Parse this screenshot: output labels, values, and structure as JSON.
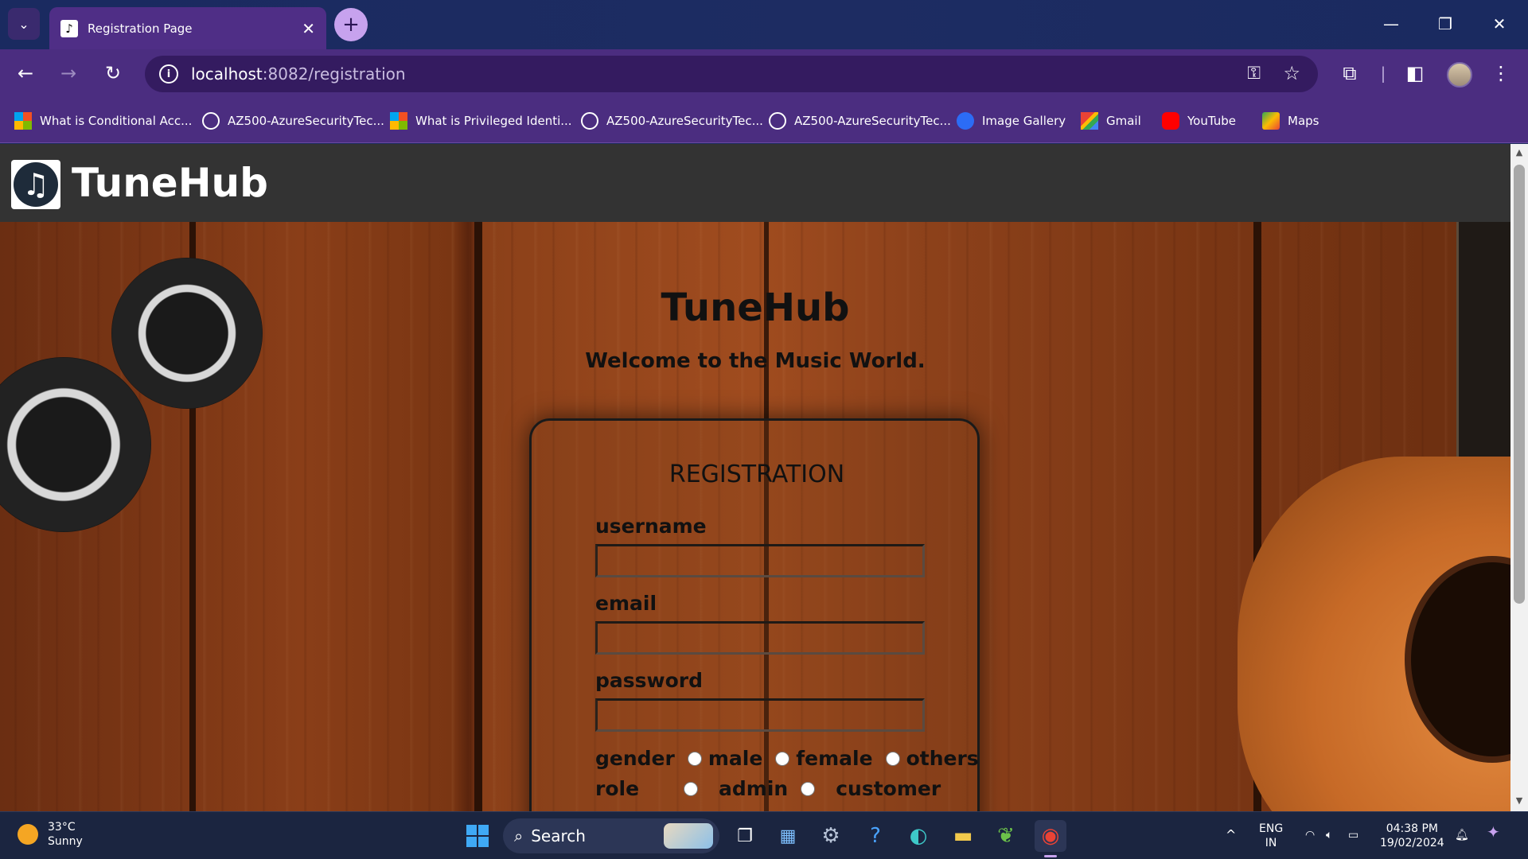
{
  "browser": {
    "tab_title": "Registration Page",
    "url_host": "localhost",
    "url_path": ":8082/registration",
    "bookmarks": [
      {
        "label": "What is Conditional Acc...",
        "icon": "microsoft-icon"
      },
      {
        "label": "AZ500-AzureSecurityTec...",
        "icon": "globe-icon"
      },
      {
        "label": "What is Privileged Identi...",
        "icon": "microsoft-icon"
      },
      {
        "label": "AZ500-AzureSecurityTec...",
        "icon": "globe-icon"
      },
      {
        "label": "AZ500-AzureSecurityTec...",
        "icon": "globe-icon"
      },
      {
        "label": "Image Gallery",
        "icon": "gallery-icon"
      },
      {
        "label": "Gmail",
        "icon": "gmail-icon"
      },
      {
        "label": "YouTube",
        "icon": "youtube-icon"
      },
      {
        "label": "Maps",
        "icon": "maps-icon"
      }
    ]
  },
  "site": {
    "brand": "TuneHub",
    "hero_title": "TuneHub",
    "hero_subtitle": "Welcome to the Music World.",
    "form": {
      "title": "REGISTRATION",
      "username_label": "username",
      "email_label": "email",
      "password_label": "password",
      "gender_label": "gender",
      "gender_options": [
        "male",
        "female",
        "others"
      ],
      "role_label": "role",
      "role_options": [
        "admin",
        "customer"
      ]
    }
  },
  "taskbar": {
    "weather_temp": "33°C",
    "weather_desc": "Sunny",
    "search_label": "Search",
    "lang_top": "ENG",
    "lang_bottom": "IN",
    "time": "04:38 PM",
    "date": "19/02/2024"
  },
  "colors": {
    "tabstrip": "#1a2a60",
    "toolbar": "#4b2d80",
    "site_header": "#333333",
    "wood": "#8a3e18"
  }
}
